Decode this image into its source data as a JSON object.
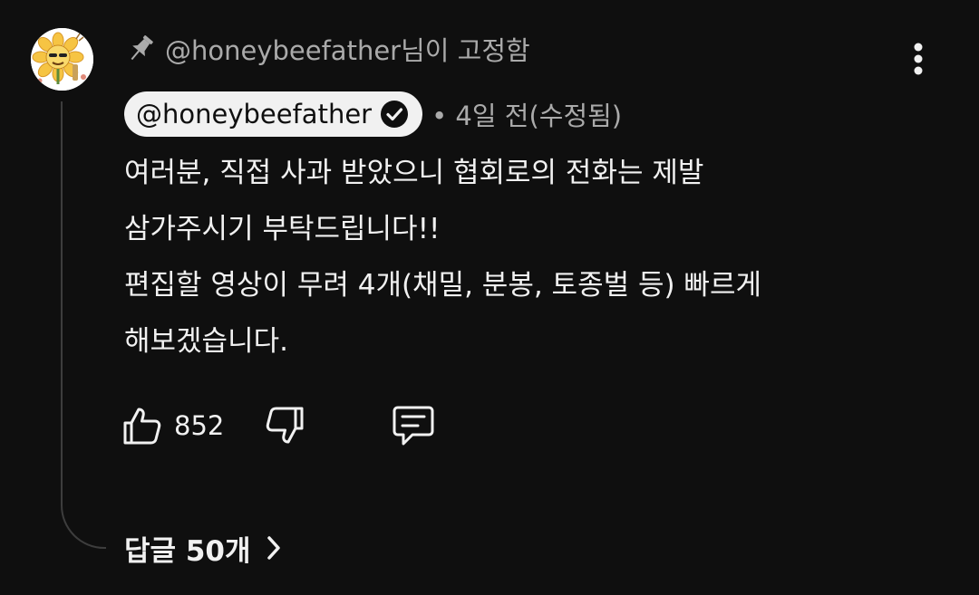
{
  "pin_label": "@honeybeefather님이 고정함",
  "comment": {
    "author": "@honeybeefather",
    "meta": "• 4일 전(수정됨)",
    "text": "여러분, 직접 사과 받았으니 협회로의 전화는 제발\n삼가주시기 부탁드립니다!!\n편집할 영상이 무려 4개(채밀, 분봉, 토종벌 등) 빠르게\n해보겠습니다."
  },
  "actions": {
    "like_count": "852"
  },
  "replies_label": "답글 50개",
  "icons": {
    "pin": "pin-icon",
    "verified": "verified-icon",
    "more": "more-vert-icon",
    "like": "thumbs-up-icon",
    "dislike": "thumbs-down-icon",
    "reply": "comment-icon",
    "chevron": "chevron-right-icon"
  },
  "colors": {
    "background": "#0f0f0f",
    "text_primary": "#f1f1f1",
    "text_secondary": "#aaaaaa",
    "thread_line": "#3d3d3d",
    "chip_background": "#f1f1f1"
  }
}
